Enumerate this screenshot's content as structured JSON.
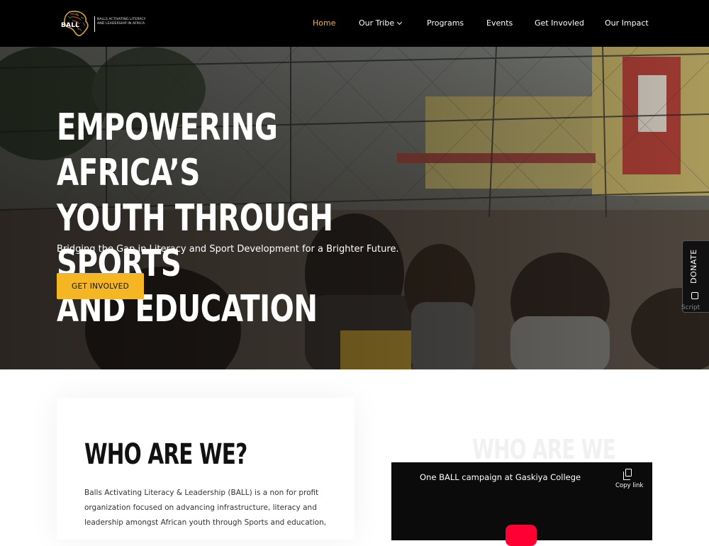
{
  "brand": {
    "name": "BALL",
    "tagline": "BALLS ACTIVATING LITERACY AND LEADERSHIP IN AFRICA"
  },
  "nav": {
    "items": [
      {
        "label": "Home",
        "active": true
      },
      {
        "label": "Our Tribe",
        "dropdown": true
      },
      {
        "label": "Programs"
      },
      {
        "label": "Events"
      },
      {
        "label": "Get Invovled"
      },
      {
        "label": "Our Impact"
      }
    ]
  },
  "hero": {
    "title_lines": [
      "EMPOWERING AFRICA’S",
      "YOUTH THROUGH SPORTS",
      "AND EDUCATION"
    ],
    "subtitle": "Bridging the Gap in Literacy and Sport Development for a Brighter Future.",
    "cta_label": "GET INVOLVED"
  },
  "donate": {
    "label": "DONATE",
    "script_text": "Script"
  },
  "about": {
    "title": "WHO ARE WE?",
    "ghost_title": "WHO ARE WE",
    "text": "Balls Activating Literacy & Leadership (BALL) is a non for profit organization focused on advancing infrastructure, literacy and leadership amongst African youth through Sports and education,"
  },
  "video": {
    "title": "One BALL campaign at Gaskiya College",
    "copy_label": "Copy link"
  },
  "colors": {
    "accent": "#f5b623",
    "nav_active": "#f5b33a",
    "nav_bg": "#000000",
    "video_play": "#ff0033"
  }
}
